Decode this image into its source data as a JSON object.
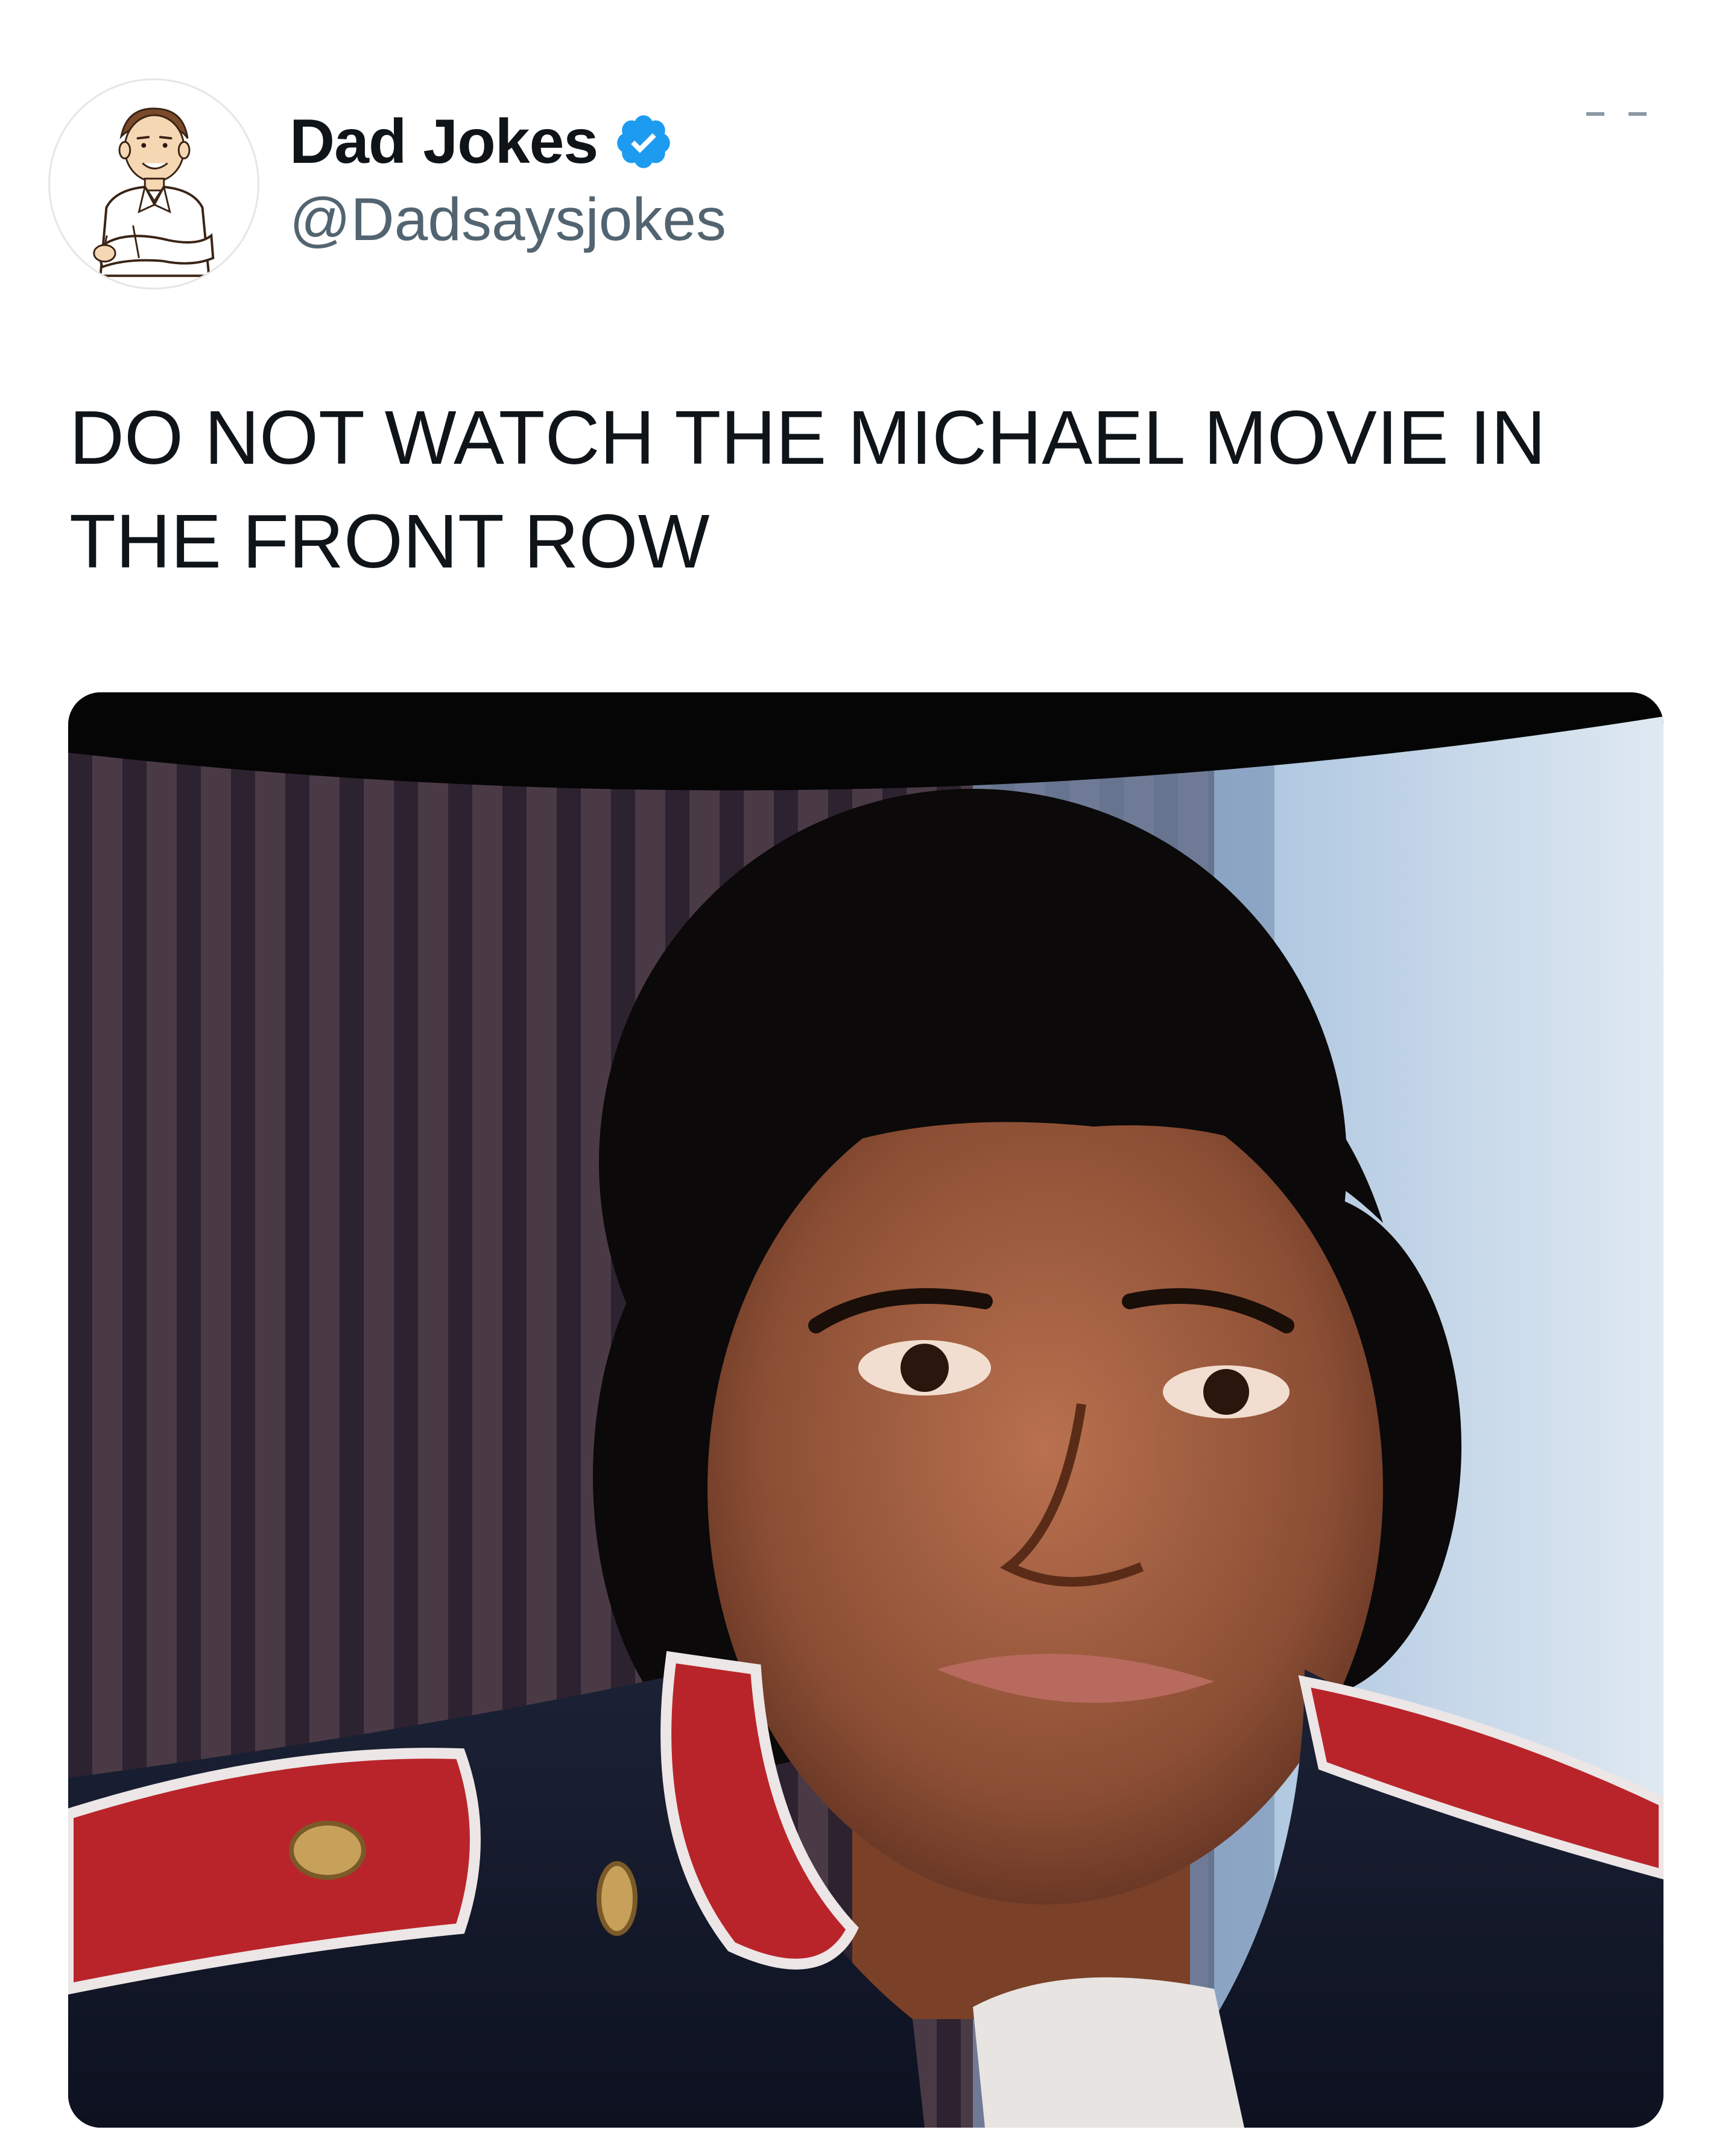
{
  "tweet": {
    "author": {
      "display_name": "Dad Jokes",
      "handle": "@Dadsaysjokes",
      "verified": true,
      "avatar_icon": "cartoon-dad-avatar-icon",
      "verified_icon": "verified-badge-icon"
    },
    "text": "DO NOT WATCH THE MICHAEL MOVIE IN THE FRONT ROW",
    "media": {
      "type": "photo",
      "icon": "movie-still-photo"
    },
    "more_icon": "more-options-icon"
  },
  "colors": {
    "verified_blue": "#1d9bf0",
    "text_primary": "#0f1419",
    "text_secondary": "#536471"
  }
}
